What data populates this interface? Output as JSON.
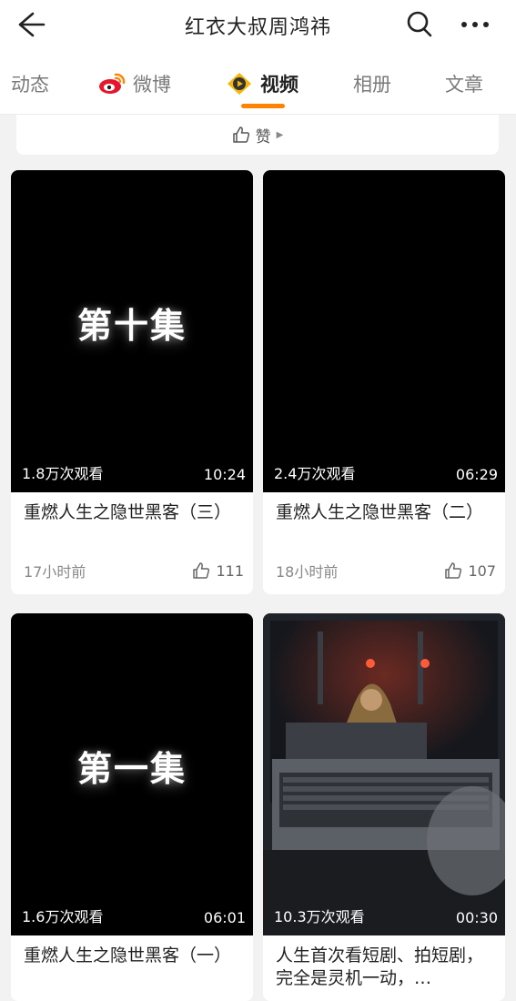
{
  "header": {
    "title": "红衣大叔周鸿祎",
    "icons": [
      "back-arrow-icon",
      "search-icon",
      "more-icon"
    ]
  },
  "tabs": [
    {
      "label": "动态",
      "active": false
    },
    {
      "label": "微博",
      "active": false,
      "icon": "weibo-icon"
    },
    {
      "label": "视频",
      "active": true,
      "icon": "video-icon"
    },
    {
      "label": "相册",
      "active": false
    },
    {
      "label": "文章",
      "active": false
    }
  ],
  "likebar": {
    "label": "赞",
    "icon": "thumb-up-icon"
  },
  "accent_color": "#ff8200",
  "videos": [
    {
      "overlay": "第十集",
      "views": "1.8万次观看",
      "duration": "10:24",
      "title": "重燃人生之隐世黑客（三）",
      "time": "17小时前",
      "likes": "111"
    },
    {
      "overlay": "",
      "views": "2.4万次观看",
      "duration": "06:29",
      "title": "重燃人生之隐世黑客（二）",
      "time": "18小时前",
      "likes": "107"
    },
    {
      "overlay": "第一集",
      "views": "1.6万次观看",
      "duration": "06:01",
      "title": "重燃人生之隐世黑客（一）"
    },
    {
      "overlay": "",
      "views": "10.3万次观看",
      "duration": "00:30",
      "title": "人生首次看短剧、拍短剧，完全是灵机一动，…"
    }
  ]
}
